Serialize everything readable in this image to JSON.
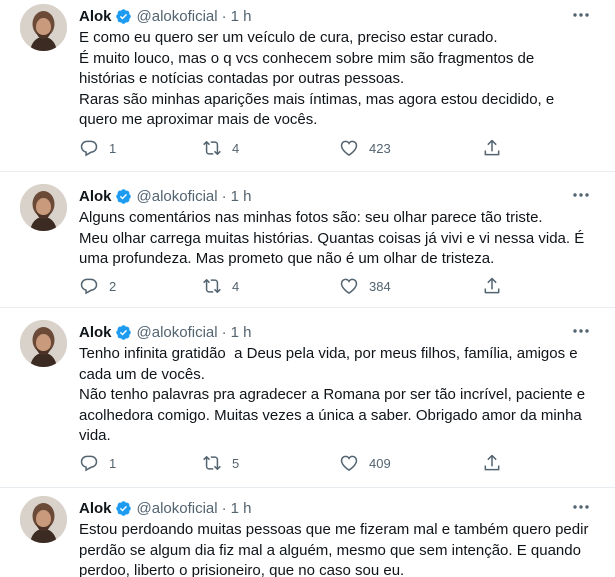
{
  "tweets": [
    {
      "author": "Alok",
      "handle": "@alokoficial",
      "separator": "·",
      "time": "1 h",
      "lines": [
        "E como eu quero ser um veículo de cura, preciso estar curado.",
        "É muito louco, mas o q vcs conhecem sobre mim são fragmentos de",
        "histórias e notícias contadas por outras pessoas.",
        "Raras são minhas aparições mais íntimas, mas agora estou decidido, e",
        "quero me aproximar mais de vocês."
      ],
      "replies": "1",
      "retweets": "4",
      "likes": "423"
    },
    {
      "author": "Alok",
      "handle": "@alokoficial",
      "separator": "·",
      "time": "1 h",
      "lines": [
        "Alguns comentários nas minhas fotos são: seu olhar parece tão triste.",
        "Meu olhar carrega muitas histórias. Quantas coisas já vivi e vi nessa vida. É",
        "uma profundeza. Mas prometo que não é um olhar de tristeza."
      ],
      "replies": "2",
      "retweets": "4",
      "likes": "384"
    },
    {
      "author": "Alok",
      "handle": "@alokoficial",
      "separator": "·",
      "time": "1 h",
      "lines": [
        "Tenho infinita gratidão  a Deus pela vida, por meus filhos, família, amigos e",
        "cada um de vocês.",
        "Não tenho palavras pra agradecer a Romana por ser tão incrível, paciente e",
        "acolhedora comigo. Muitas vezes a única a saber. Obrigado amor da minha",
        "vida."
      ],
      "replies": "1",
      "retweets": "5",
      "likes": "409"
    },
    {
      "author": "Alok",
      "handle": "@alokoficial",
      "separator": "·",
      "time": "1 h",
      "lines": [
        "Estou perdoando muitas pessoas que me fizeram mal e também quero pedir",
        "perdão se algum dia fiz mal a alguém, mesmo que sem intenção. E quando",
        "perdoo, liberto o prisioneiro, que no caso sou eu."
      ]
    }
  ],
  "colors": {
    "verified": "#1d9bf0",
    "secondary_text": "#536471",
    "divider": "#e6ecf0"
  },
  "icons": [
    "verified-badge-icon",
    "more-icon",
    "reply-icon",
    "retweet-icon",
    "like-icon",
    "share-icon"
  ]
}
